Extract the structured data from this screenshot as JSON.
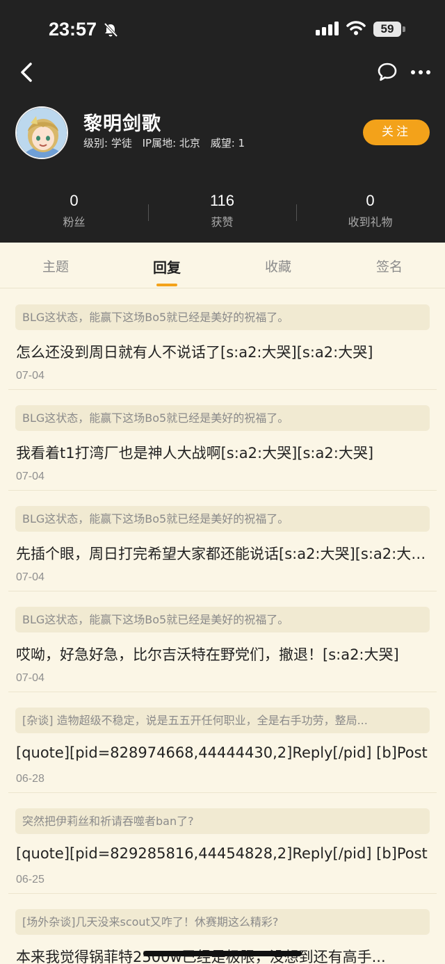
{
  "status_bar": {
    "time": "23:57",
    "battery": "59"
  },
  "profile": {
    "username": "黎明剑歌",
    "level": "级别: 学徒",
    "ip": "IP属地: 北京",
    "reputation": "威望: 1",
    "follow_label": "关注"
  },
  "stats": [
    {
      "value": "0",
      "label": "粉丝"
    },
    {
      "value": "116",
      "label": "获赞"
    },
    {
      "value": "0",
      "label": "收到礼物"
    }
  ],
  "tabs": [
    {
      "label": "主题"
    },
    {
      "label": "回复"
    },
    {
      "label": "收藏"
    },
    {
      "label": "签名"
    }
  ],
  "active_tab": "回复",
  "replies": [
    {
      "quote": "BLG这状态，能赢下这场Bo5就已经是美好的祝福了。",
      "text": "怎么还没到周日就有人不说话了[s:a2:大哭][s:a2:大哭]",
      "date": "07-04"
    },
    {
      "quote": "BLG这状态，能赢下这场Bo5就已经是美好的祝福了。",
      "text": "我看着t1打湾厂也是神人大战啊[s:a2:大哭][s:a2:大哭]",
      "date": "07-04"
    },
    {
      "quote": "BLG这状态，能赢下这场Bo5就已经是美好的祝福了。",
      "text": "先插个眼，周日打完希望大家都还能说话[s:a2:大哭][s:a2:大哭]",
      "date": "07-04"
    },
    {
      "quote": "BLG这状态，能赢下这场Bo5就已经是美好的祝福了。",
      "text": "哎呦，好急好急，比尔吉沃特在野党们，撤退！[s:a2:大哭]",
      "date": "07-04"
    },
    {
      "quote": "[杂谈] 造物超级不稳定，说是五五开任何职业，全是右手功劳，整局...",
      "text": "[quote][pid=828974668,44444430,2]Reply[/pid] [b]Post",
      "date": "06-28"
    },
    {
      "quote": "突然把伊莉丝和祈请吞噬者ban了?",
      "text": "[quote][pid=829285816,44454828,2]Reply[/pid] [b]Post",
      "date": "06-25"
    },
    {
      "quote": "[场外杂谈]几天没来scout又咋了！休赛期这么精彩?",
      "text": "本来我觉得锅菲特2500w已经是极限，没想到还有高手...",
      "date": ""
    }
  ],
  "colors": {
    "header_bg": "#222222",
    "page_bg": "#fbf6e6",
    "accent": "#f3a21a",
    "quote_bg": "#f1ead2"
  },
  "icons": [
    "bell-off-icon",
    "signal-icon",
    "wifi-icon",
    "battery-icon",
    "back-arrow-icon",
    "chat-bubble-icon",
    "more-icon"
  ]
}
